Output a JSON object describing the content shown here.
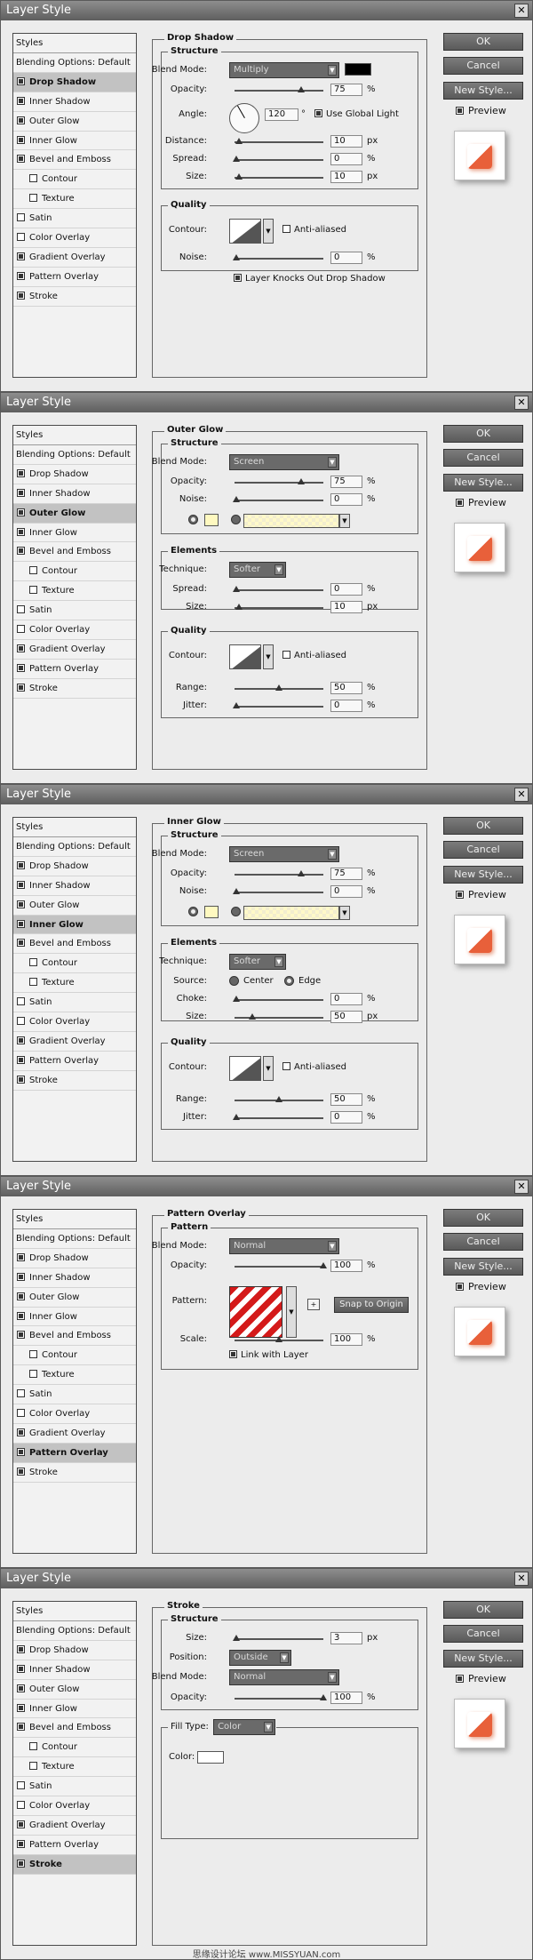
{
  "dialog_title": "Layer Style",
  "close_glyph": "✕",
  "styles_header": "Styles",
  "blending_options": "Blending Options: Default",
  "buttons": {
    "ok": "OK",
    "cancel": "Cancel",
    "new_style": "New Style...",
    "preview": "Preview"
  },
  "style_items": [
    "Drop Shadow",
    "Inner Shadow",
    "Outer Glow",
    "Inner Glow",
    "Bevel and Emboss",
    "Contour",
    "Texture",
    "Satin",
    "Color Overlay",
    "Gradient Overlay",
    "Pattern Overlay",
    "Stroke"
  ],
  "common": {
    "structure": "Structure",
    "quality": "Quality",
    "elements": "Elements",
    "pattern": "Pattern",
    "blend_mode": "Blend Mode:",
    "opacity": "Opacity:",
    "noise": "Noise:",
    "contour": "Contour:",
    "anti_aliased": "Anti-aliased",
    "technique": "Technique:",
    "spread": "Spread:",
    "size": "Size:",
    "range": "Range:",
    "jitter": "Jitter:",
    "percent": "%",
    "px": "px",
    "arrow": "▼",
    "degree": "°"
  },
  "drop_shadow": {
    "title": "Drop Shadow",
    "blend_mode": "Multiply",
    "blend_color": "#000000",
    "opacity": "75",
    "angle_label": "Angle:",
    "angle": "120",
    "use_global_light": "Use Global Light",
    "distance_label": "Distance:",
    "distance": "10",
    "spread": "0",
    "size": "10",
    "noise": "0",
    "knocks_out": "Layer Knocks Out Drop Shadow"
  },
  "outer_glow": {
    "title": "Outer Glow",
    "blend_mode": "Screen",
    "opacity": "75",
    "noise": "0",
    "glow_color": "#fff9c0",
    "technique": "Softer",
    "spread": "0",
    "size": "10",
    "range": "50",
    "jitter": "0"
  },
  "inner_glow": {
    "title": "Inner Glow",
    "blend_mode": "Screen",
    "opacity": "75",
    "noise": "0",
    "glow_color": "#fff9c0",
    "technique": "Softer",
    "source_label": "Source:",
    "center": "Center",
    "edge": "Edge",
    "choke_label": "Choke:",
    "choke": "0",
    "size": "50",
    "range": "50",
    "jitter": "0"
  },
  "pattern_overlay": {
    "title": "Pattern Overlay",
    "blend_mode": "Normal",
    "opacity": "100",
    "pattern_label": "Pattern:",
    "snap_to_origin": "Snap to Origin",
    "scale_label": "Scale:",
    "scale": "100",
    "link_with_layer": "Link with Layer",
    "new_preset_glyph": "+"
  },
  "stroke": {
    "title": "Stroke",
    "size": "3",
    "position_label": "Position:",
    "position": "Outside",
    "blend_mode": "Normal",
    "opacity": "100",
    "fill_type_label": "Fill Type:",
    "fill_type": "Color",
    "color_label": "Color:",
    "color": "#ffffff"
  },
  "watermark": "思缘设计论坛 www.MISSYUAN.com"
}
